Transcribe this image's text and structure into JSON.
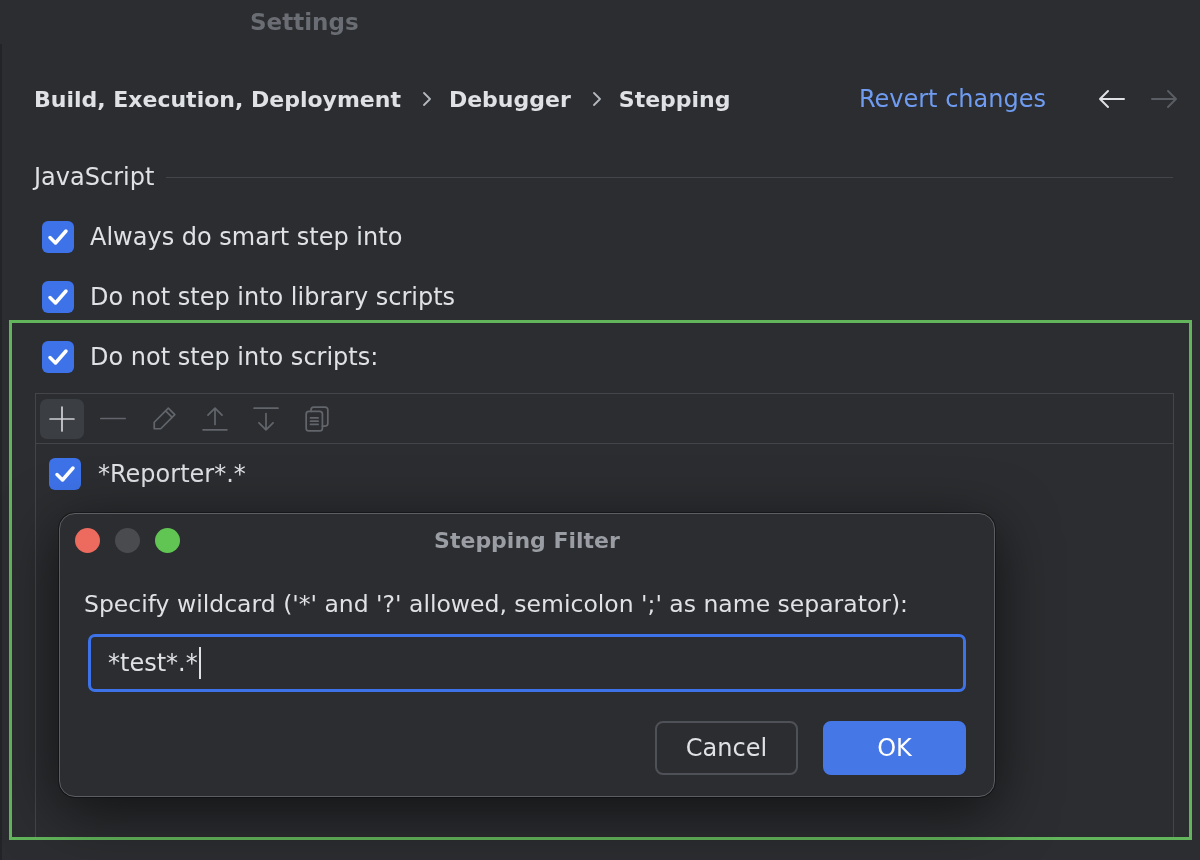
{
  "window": {
    "title": "Settings"
  },
  "breadcrumb": [
    "Build, Execution, Deployment",
    "Debugger",
    "Stepping"
  ],
  "revert_link": "Revert changes",
  "history_nav": [
    {
      "kind": "back",
      "disabled": false
    },
    {
      "kind": "forward",
      "disabled": true
    }
  ],
  "section": {
    "title": "JavaScript",
    "options": [
      {
        "label": "Always do smart step into",
        "checked": true
      },
      {
        "label": "Do not step into library scripts",
        "checked": true
      }
    ]
  },
  "scripts_filter": {
    "highlighted": true,
    "label": "Do not step into scripts:",
    "checked": true,
    "toolbar": [
      {
        "kind": "add",
        "highlighted": true,
        "disabled": false
      },
      {
        "kind": "remove",
        "highlighted": false,
        "disabled": true
      },
      {
        "kind": "edit",
        "highlighted": false,
        "disabled": true
      },
      {
        "kind": "move_up",
        "highlighted": false,
        "disabled": true
      },
      {
        "kind": "move_down",
        "highlighted": false,
        "disabled": true
      },
      {
        "kind": "copy",
        "highlighted": false,
        "disabled": true
      }
    ],
    "items": [
      {
        "pattern": "*Reporter*.*",
        "checked": true
      }
    ]
  },
  "dialog": {
    "title": "Stepping Filter",
    "window_buttons": [
      {
        "kind": "close",
        "disabled": false
      },
      {
        "kind": "minimize",
        "disabled": true
      },
      {
        "kind": "zoom",
        "disabled": false
      }
    ],
    "prompt": "Specify wildcard ('*' and '?' allowed, semicolon ';' as name separator):",
    "input": {
      "value": "*test*.*",
      "focused": true
    },
    "buttons": [
      {
        "label": "Cancel",
        "kind": "secondary"
      },
      {
        "label": "OK",
        "kind": "primary"
      }
    ]
  }
}
